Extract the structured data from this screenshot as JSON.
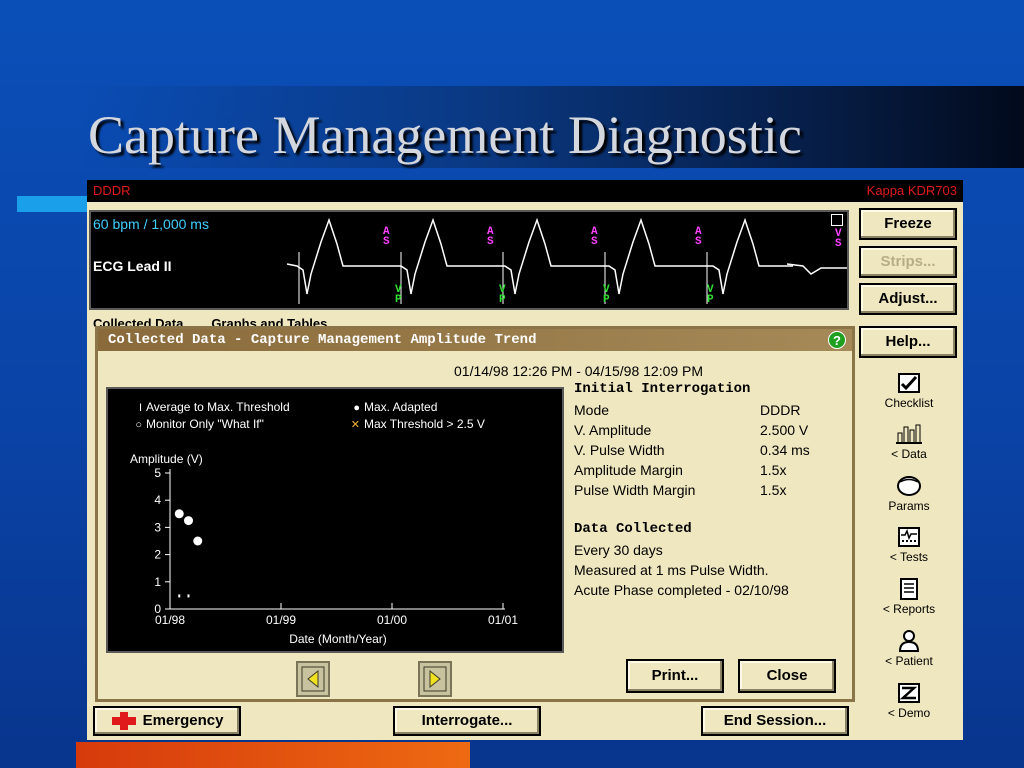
{
  "slide": {
    "title": "Capture Management Diagnostic"
  },
  "device": {
    "mode": "DDDR",
    "model": "Kappa KDR703"
  },
  "ecg": {
    "rate": "60 bpm / 1,000 ms",
    "lead": "ECG Lead II",
    "atrial_marker": [
      "A",
      "S"
    ],
    "ventricular_marker": [
      "V",
      "P"
    ],
    "end_marker": [
      "V",
      "S"
    ]
  },
  "side_buttons": {
    "freeze": "Freeze",
    "strips": "Strips...",
    "adjust": "Adjust...",
    "help": "Help..."
  },
  "under_tabs": {
    "collected": "Collected Data",
    "graphs": "Graphs and Tables"
  },
  "dialog": {
    "title": "Collected Data - Capture Management Amplitude Trend",
    "help_icon": "?",
    "date_range": "01/14/98 12:26 PM - 04/15/98 12:09 PM",
    "initial_heading": "Initial Interrogation",
    "initial_rows": [
      {
        "label": "Mode",
        "value": "DDDR"
      },
      {
        "label": "V. Amplitude",
        "value": "2.500 V"
      },
      {
        "label": "V. Pulse Width",
        "value": "0.34 ms"
      },
      {
        "label": "Amplitude Margin",
        "value": "1.5x"
      },
      {
        "label": "Pulse Width Margin",
        "value": "1.5x"
      }
    ],
    "collected_heading": "Data Collected",
    "collected_lines": [
      "Every 30 days",
      "Measured at 1 ms Pulse Width.",
      "Acute Phase completed - 02/10/98"
    ],
    "print_label": "Print...",
    "close_label": "Close"
  },
  "chart_data": {
    "type": "scatter",
    "legend": [
      {
        "symbol": "I",
        "label": "Average to Max. Threshold"
      },
      {
        "symbol": "●",
        "label": "Max. Adapted"
      },
      {
        "symbol": "○",
        "label": "Monitor Only \"What If\""
      },
      {
        "symbol": "✕",
        "label": "Max Threshold > 2.5 V"
      }
    ],
    "ylabel": "Amplitude (V)",
    "xlabel": "Date (Month/Year)",
    "ylim": [
      0,
      5
    ],
    "yticks": [
      "0",
      "1",
      "2",
      "3",
      "4",
      "5"
    ],
    "xticks": [
      "01/98",
      "01/99",
      "01/00",
      "01/01"
    ],
    "series": [
      {
        "name": "Max. Adapted",
        "x": [
          "02/98",
          "03/98",
          "04/98"
        ],
        "values": [
          3.5,
          3.25,
          2.5
        ]
      },
      {
        "name": "Average to Max. Threshold",
        "x": [
          "02/98",
          "03/98"
        ],
        "values": [
          0.5,
          0.5
        ]
      }
    ]
  },
  "right_panel": [
    {
      "label": "Checklist",
      "icon": "checklist-icon"
    },
    {
      "label": "< Data",
      "icon": "data-icon"
    },
    {
      "label": "Params",
      "icon": "params-icon"
    },
    {
      "label": "< Tests",
      "icon": "tests-icon"
    },
    {
      "label": "< Reports",
      "icon": "reports-icon"
    },
    {
      "label": "< Patient",
      "icon": "patient-icon"
    },
    {
      "label": "< Demo",
      "icon": "demo-icon"
    }
  ],
  "bottom_buttons": {
    "emergency": "Emergency",
    "interrogate": "Interrogate...",
    "end_session": "End Session..."
  },
  "colors": {
    "slide_bg": "#0a4fb8",
    "screen_bg": "#efe7bf",
    "ecg_trace": "#ffffff",
    "atrial_marker": "#ff40ff",
    "ventricular_marker": "#30e030",
    "device_label": "#e01a1a",
    "emergency_icon": "#e01a1a"
  }
}
